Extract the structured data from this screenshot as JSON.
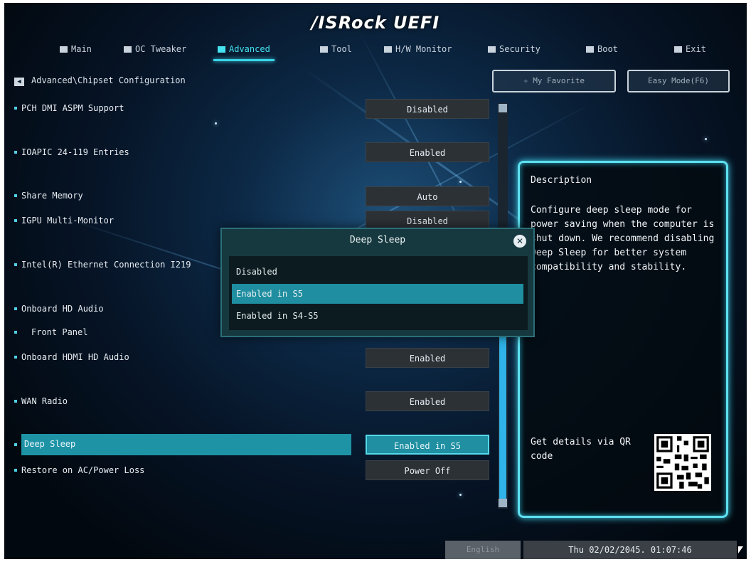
{
  "header": {
    "logo": "/ISRock UEFI"
  },
  "tabs": [
    {
      "label": "Main",
      "icon": "grid-icon"
    },
    {
      "label": "OC Tweaker",
      "icon": "person-icon"
    },
    {
      "label": "Advanced",
      "icon": "star-icon",
      "active": true
    },
    {
      "label": "Tool",
      "icon": "tools-icon"
    },
    {
      "label": "H/W Monitor",
      "icon": "monitor-icon"
    },
    {
      "label": "Security",
      "icon": "shield-icon"
    },
    {
      "label": "Boot",
      "icon": "power-icon"
    },
    {
      "label": "Exit",
      "icon": "exit-icon"
    }
  ],
  "breadcrumb": "Advanced\\Chipset Configuration",
  "top_buttons": {
    "favorite": "My Favorite",
    "easy_mode": "Easy Mode(F6)"
  },
  "settings": [
    {
      "label": "PCH DMI ASPM Support",
      "value": "Disabled"
    },
    {
      "label": "IOAPIC 24-119 Entries",
      "value": "Enabled"
    },
    {
      "label": "Share Memory",
      "value": "Auto"
    },
    {
      "label": "IGPU Multi-Monitor",
      "value": "Disabled"
    },
    {
      "label": "Intel(R) Ethernet Connection I219",
      "value": ""
    },
    {
      "label": "Onboard HD Audio",
      "value": ""
    },
    {
      "label": "Front Panel",
      "value": ""
    },
    {
      "label": "Onboard HDMI HD Audio",
      "value": "Enabled"
    },
    {
      "label": "WAN Radio",
      "value": "Enabled"
    },
    {
      "label": "Deep Sleep",
      "value": "Enabled in S5",
      "selected": true
    },
    {
      "label": "Restore on AC/Power Loss",
      "value": "Power Off"
    }
  ],
  "dialog": {
    "title": "Deep Sleep",
    "options": [
      "Disabled",
      "Enabled in S5",
      "Enabled in S4-S5"
    ],
    "highlighted": "Enabled in S5"
  },
  "description": {
    "title": "Description",
    "text": "Configure deep sleep mode for power saving when the computer is shut down. We recommend disabling Deep Sleep for better system compatibility and stability.",
    "qr_label": "Get details via QR code"
  },
  "footer": {
    "language": "English",
    "datetime": "Thu 02/02/2045. 01:07:46"
  },
  "colors": {
    "accent": "#45e3f0",
    "selection": "#1f8ea0",
    "background": "#061426"
  }
}
